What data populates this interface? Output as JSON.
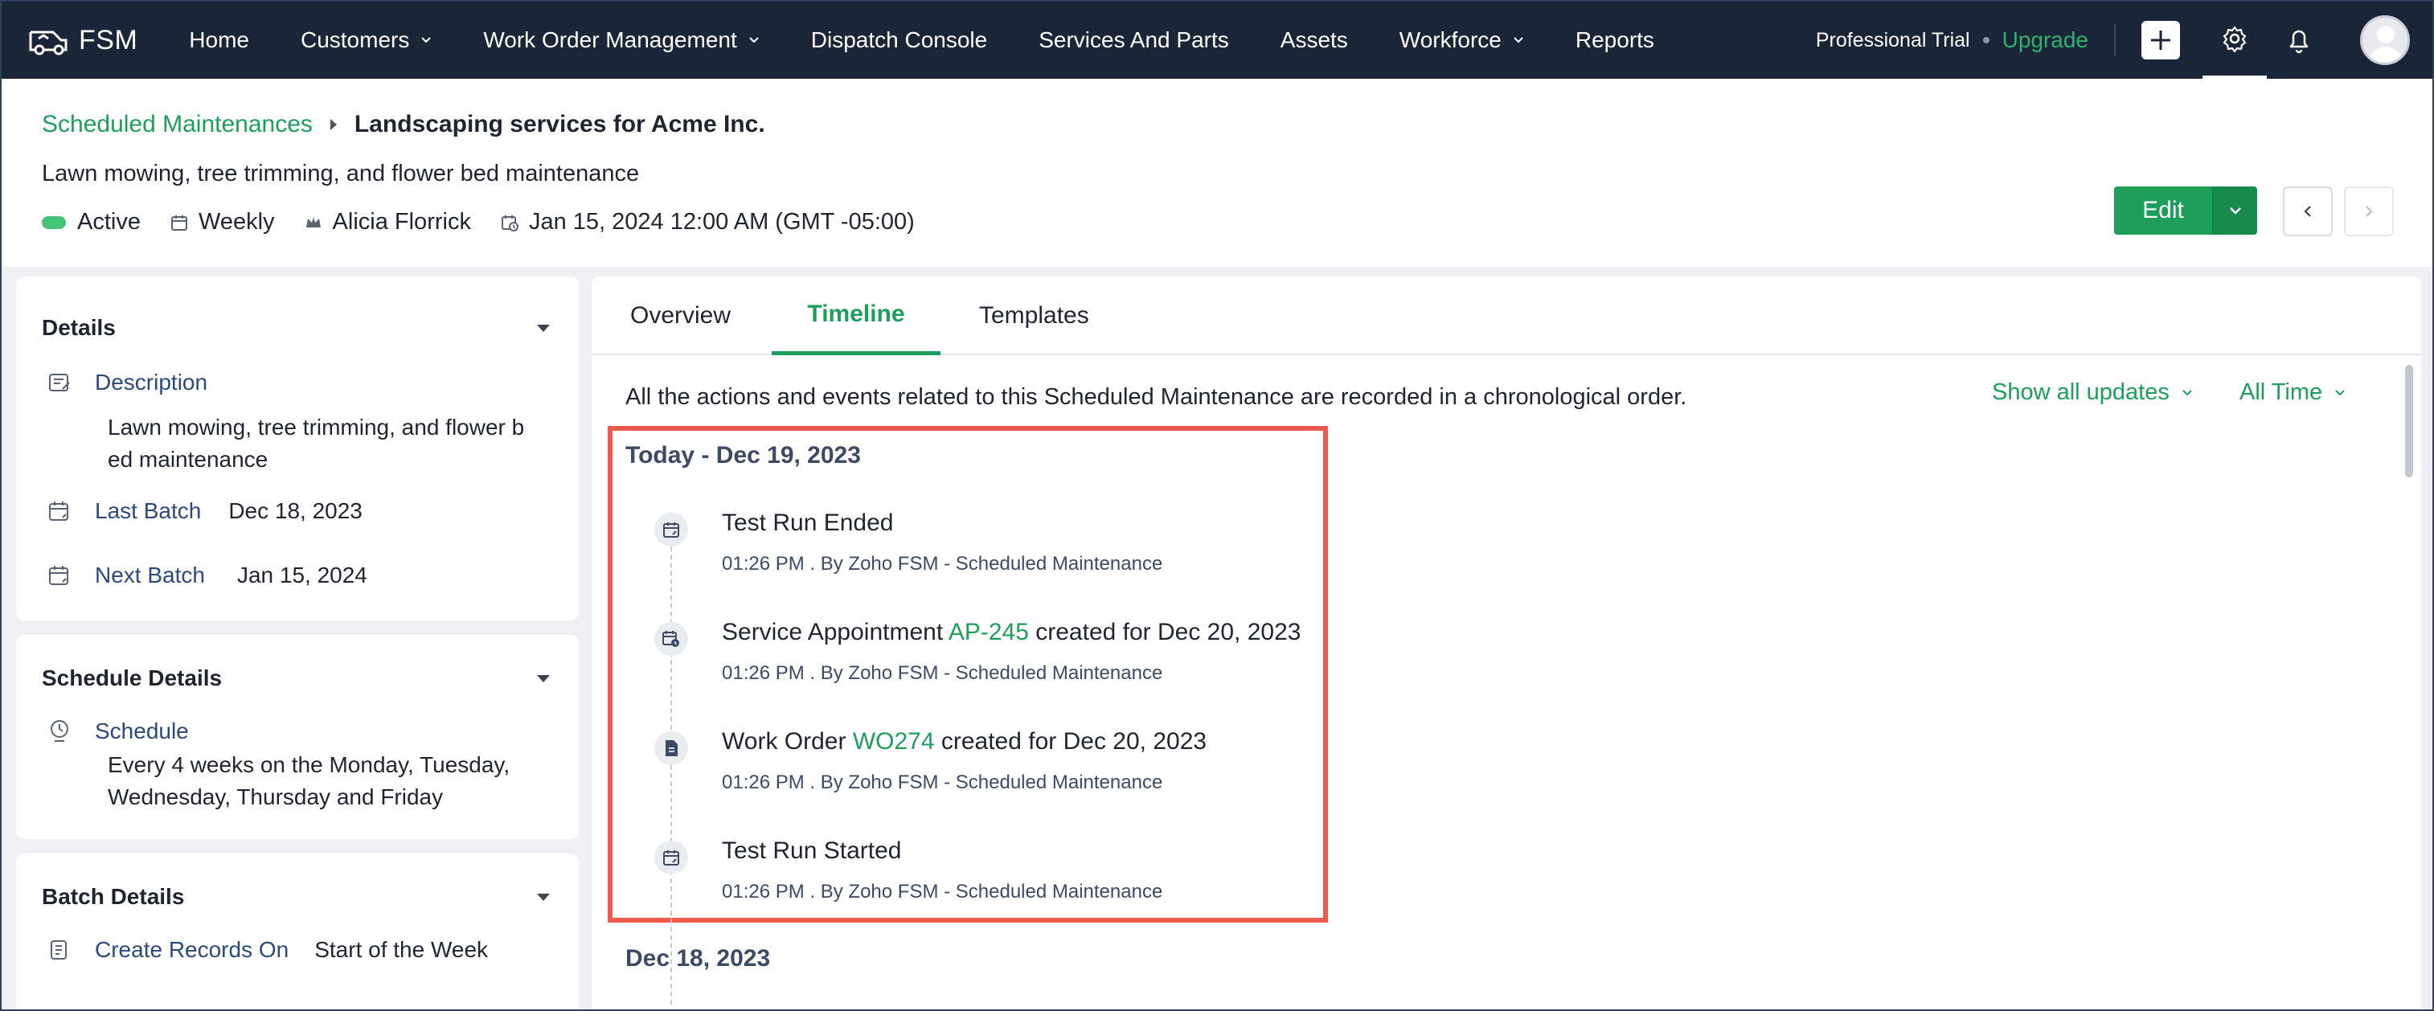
{
  "app": {
    "name": "FSM",
    "colors": {
      "nav_bg": "#1b2538",
      "accent_green": "#1e9e5a",
      "highlight_red": "#ef5a4c",
      "status_active": "#46c277"
    }
  },
  "nav": {
    "items": [
      {
        "label": "Home",
        "dropdown": false
      },
      {
        "label": "Customers",
        "dropdown": true
      },
      {
        "label": "Work Order Management",
        "dropdown": true
      },
      {
        "label": "Dispatch Console",
        "dropdown": false
      },
      {
        "label": "Services And Parts",
        "dropdown": false
      },
      {
        "label": "Assets",
        "dropdown": false
      },
      {
        "label": "Workforce",
        "dropdown": true
      },
      {
        "label": "Reports",
        "dropdown": false
      }
    ],
    "trial_label": "Professional Trial",
    "upgrade_label": "Upgrade",
    "icons": [
      "add-icon",
      "gear-icon",
      "bell-icon",
      "avatar"
    ]
  },
  "header": {
    "breadcrumb_parent": "Scheduled Maintenances",
    "breadcrumb_current": "Landscaping services for Acme Inc.",
    "subtitle": "Lawn mowing, tree trimming, and flower bed maintenance",
    "status": "Active",
    "frequency": "Weekly",
    "owner": "Alicia Florrick",
    "start_datetime": "Jan 15, 2024 12:00 AM (GMT -05:00)",
    "edit_label": "Edit"
  },
  "details": {
    "title": "Details",
    "description_label": "Description",
    "description_line1": "Lawn mowing, tree trimming, and flower b",
    "description_line2": "ed maintenance",
    "last_batch_label": "Last Batch",
    "last_batch_value": "Dec 18, 2023",
    "next_batch_label": "Next Batch",
    "next_batch_value": "Jan 15, 2024"
  },
  "schedule": {
    "title": "Schedule Details",
    "schedule_label": "Schedule",
    "schedule_line1": "Every 4 weeks on the Monday, Tuesday,",
    "schedule_line2": "Wednesday, Thursday and Friday"
  },
  "batch": {
    "title": "Batch Details",
    "create_label": "Create Records On",
    "create_value": "Start of the Week"
  },
  "tabs": [
    "Overview",
    "Timeline",
    "Templates"
  ],
  "active_tab": "Timeline",
  "timeline": {
    "intro": "All the actions and events related to this Scheduled Maintenance are recorded in a chronological order.",
    "filter_updates": "Show all updates",
    "filter_time": "All Time",
    "group1_date": "Today - Dec 19, 2023",
    "events": [
      {
        "icon": "calendar-icon",
        "title": "Test Run Ended",
        "meta": "01:26 PM . By Zoho FSM - Scheduled Maintenance"
      },
      {
        "icon": "appointment-icon",
        "title_pre": "Service Appointment ",
        "link": "AP-245",
        "title_post": " created for Dec 20, 2023",
        "meta": "01:26 PM . By Zoho FSM - Scheduled Maintenance"
      },
      {
        "icon": "document-icon",
        "title_pre": "Work Order ",
        "link": "WO274",
        "title_post": " created for Dec 20, 2023",
        "meta": "01:26 PM . By Zoho FSM - Scheduled Maintenance"
      },
      {
        "icon": "calendar-icon",
        "title": "Test Run Started",
        "meta": "01:26 PM . By Zoho FSM - Scheduled Maintenance"
      }
    ],
    "group2_date": "Dec 18, 2023"
  }
}
